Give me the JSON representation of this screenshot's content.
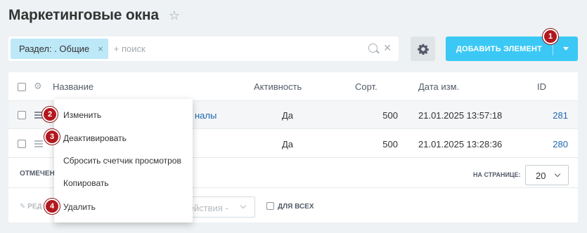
{
  "page_title": "Маркетинговые окна",
  "filter": {
    "chip_label": "Раздел: . Общие",
    "chip_close": "×",
    "placeholder": "+ поиск"
  },
  "add_button": {
    "label": "ДОБАВИТЬ ЭЛЕМЕНТ"
  },
  "table": {
    "headers": {
      "name": "Название",
      "active": "Активность",
      "sort": "Сорт.",
      "date": "Дата изм.",
      "id": "ID"
    },
    "rows": [
      {
        "name_fragment": "налы",
        "active": "Да",
        "sort": "500",
        "date": "21.01.2025 13:57:18",
        "id": "281"
      },
      {
        "name_fragment": "",
        "active": "Да",
        "sort": "500",
        "date": "21.01.2025 13:28:36",
        "id": "280"
      }
    ]
  },
  "footer": {
    "selected_label": "ОТМЕЧЕН",
    "per_page_label": "НА СТРАНИЦЕ:",
    "per_page_value": "20",
    "edit_label": "РЕД",
    "actions_placeholder": "действия -",
    "for_all_label": "ДЛЯ ВСЕХ"
  },
  "context_menu": {
    "items": [
      "Изменить",
      "Деактивировать",
      "Сбросить счетчик просмотров",
      "Копировать",
      "Удалить"
    ]
  },
  "badges": [
    "1",
    "2",
    "3",
    "4"
  ],
  "colors": {
    "accent": "#3bc8f5",
    "badge": "#b2171d",
    "link": "#2067b0",
    "chip": "#bde8f7"
  }
}
